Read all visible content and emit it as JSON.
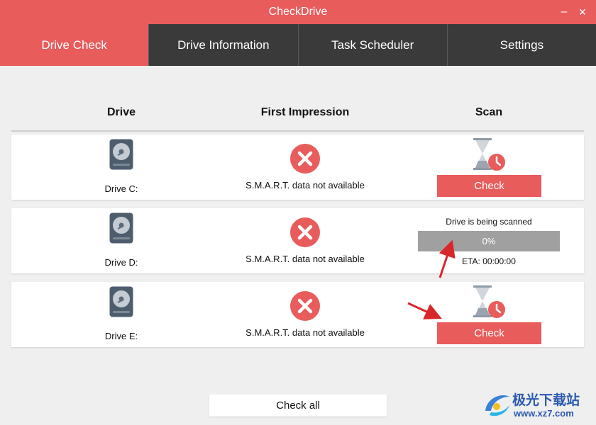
{
  "window": {
    "title": "CheckDrive",
    "minimize_glyph": "–",
    "close_glyph": "×"
  },
  "tabs": [
    {
      "label": "Drive Check",
      "active": true
    },
    {
      "label": "Drive Information",
      "active": false
    },
    {
      "label": "Task Scheduler",
      "active": false
    },
    {
      "label": "Settings",
      "active": false
    }
  ],
  "table": {
    "headers": {
      "drive": "Drive",
      "impression": "First Impression",
      "scan": "Scan"
    },
    "rows": [
      {
        "drive": "Drive C:",
        "impression": "S.M.A.R.T. data not available",
        "scan_state": "idle",
        "button": "Check"
      },
      {
        "drive": "Drive D:",
        "impression": "S.M.A.R.T. data not available",
        "scan_state": "scanning",
        "scan_status": "Drive is being scanned",
        "progress_text": "0%",
        "progress": 0,
        "eta": "ETA:  00:00:00"
      },
      {
        "drive": "Drive E:",
        "impression": "S.M.A.R.T. data not available",
        "scan_state": "idle",
        "button": "Check"
      }
    ]
  },
  "footer": {
    "check_all": "Check all"
  },
  "watermark": {
    "line1": "极光下载站",
    "line2": "www.xz7.com"
  },
  "colors": {
    "accent": "#e85c5c",
    "tab_bg": "#3a3a3a",
    "progress_bg": "#a0a0a0",
    "error_icon": "#e85c5c"
  },
  "icons": {
    "drive": "hard-drive-icon",
    "status": "error-x-icon",
    "scan": "hourglass-clock-icon"
  }
}
